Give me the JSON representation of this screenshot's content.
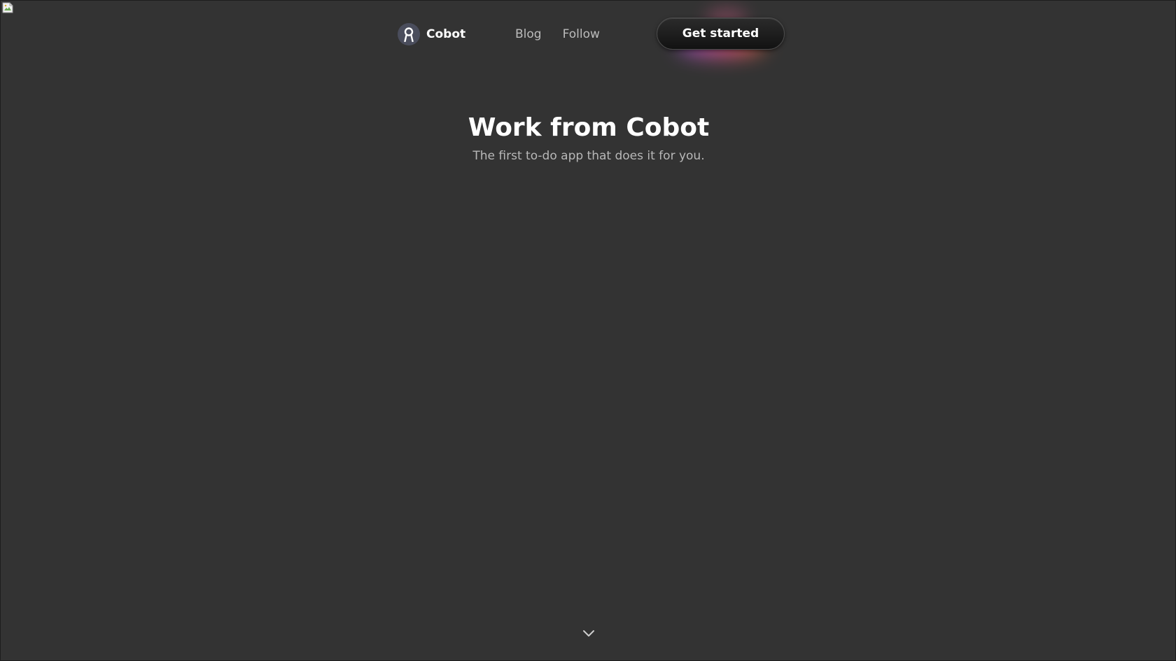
{
  "header": {
    "brand": {
      "name": "Cobot",
      "logo_icon": "user-avatar-icon"
    },
    "nav": [
      {
        "label": "Blog"
      },
      {
        "label": "Follow"
      }
    ],
    "cta_label": "Get started"
  },
  "hero": {
    "title": "Work from Cobot",
    "subtitle": "The first to-do app that does it for you."
  },
  "scroll_icon": "chevron-down-icon",
  "colors": {
    "background": "#333333",
    "text_primary": "#ffffff",
    "text_muted": "#b8b8b8",
    "glow_start": "#b55cff",
    "glow_end": "#ff7a3d"
  }
}
